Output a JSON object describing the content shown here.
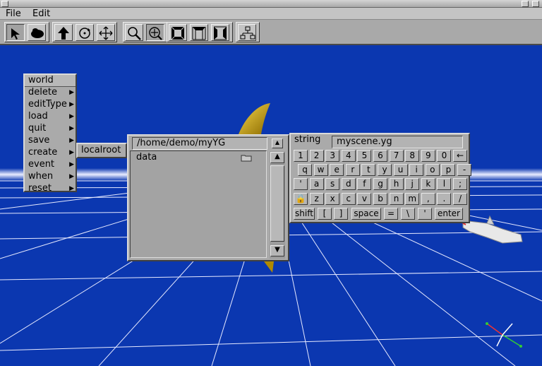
{
  "menubar": {
    "file": "File",
    "edit": "Edit"
  },
  "toolbar": {
    "tools": [
      {
        "name": "select-arrow-icon"
      },
      {
        "name": "fly-icon"
      },
      {
        "name": "move-up-icon"
      },
      {
        "name": "rotate-icon"
      },
      {
        "name": "translate-icon"
      },
      {
        "name": "zoom-icon"
      },
      {
        "name": "zoom-in-icon"
      },
      {
        "name": "front-view-icon"
      },
      {
        "name": "top-view-icon"
      },
      {
        "name": "side-view-icon"
      },
      {
        "name": "scene-graph-icon"
      }
    ]
  },
  "world_menu": {
    "title": "world",
    "items": [
      "delete",
      "editType",
      "load",
      "quit",
      "save",
      "create",
      "event",
      "when",
      "reset"
    ]
  },
  "submenu": {
    "item": "localroot"
  },
  "file_browser": {
    "path": "/home/demo/myYG",
    "entries": [
      {
        "label": "data",
        "icon": "folder-icon"
      }
    ]
  },
  "keyboard": {
    "field_label": "string",
    "field_value": "myscene.yg",
    "rows": [
      [
        "1",
        "2",
        "3",
        "4",
        "5",
        "6",
        "7",
        "8",
        "9",
        "0",
        "←"
      ],
      [
        "q",
        "w",
        "e",
        "r",
        "t",
        "y",
        "u",
        "i",
        "o",
        "p",
        "-"
      ],
      [
        "'",
        "a",
        "s",
        "d",
        "f",
        "g",
        "h",
        "j",
        "k",
        "l",
        ";"
      ],
      [
        "🔒",
        "z",
        "x",
        "c",
        "v",
        "b",
        "n",
        "m",
        ",",
        ".",
        "/"
      ]
    ],
    "bottom": {
      "shift": "shift",
      "lbracket": "[",
      "rbracket": "]",
      "space": "space",
      "equals": "=",
      "backslash": "\\",
      "quote": "'",
      "enter": "enter"
    }
  },
  "colors": {
    "background": "#0b37b0",
    "panel": "#aaaaaa",
    "object": "#f2c51c"
  }
}
